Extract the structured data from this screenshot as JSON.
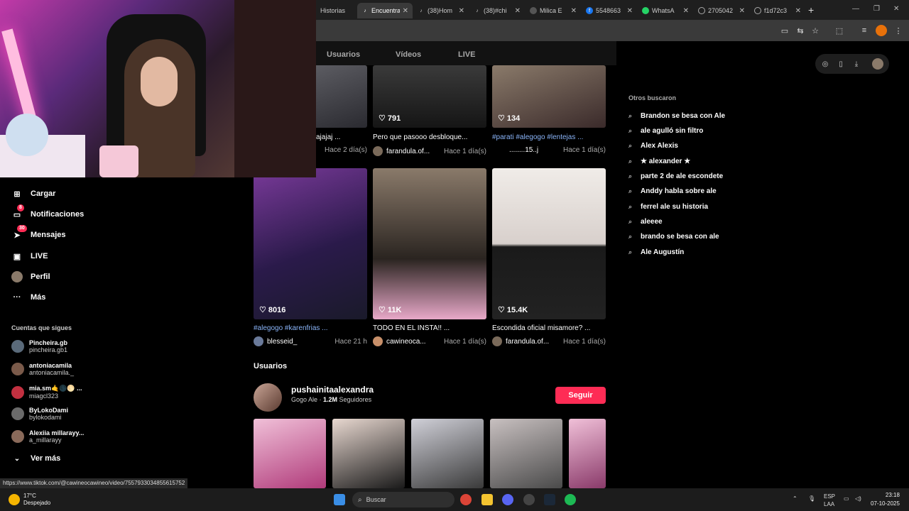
{
  "browser": {
    "tabs": [
      {
        "label": "Historias",
        "icon": "tiktok-icon",
        "active": false
      },
      {
        "label": "Encuentra",
        "icon": "tiktok-icon",
        "active": true
      },
      {
        "label": "(38)Hom",
        "icon": "tiktok-icon",
        "active": false
      },
      {
        "label": "(38)#chi",
        "icon": "tiktok-icon",
        "active": false
      },
      {
        "label": "Milica E",
        "icon": "site-icon",
        "active": false
      },
      {
        "label": "5548663",
        "icon": "facebook-icon",
        "active": false
      },
      {
        "label": "WhatsA",
        "icon": "whatsapp-icon",
        "active": false
      },
      {
        "label": "2705042",
        "icon": "globe-icon",
        "active": false
      },
      {
        "label": "f1d72c3",
        "icon": "globe-icon",
        "active": false
      }
    ],
    "status_url": "https://www.tiktok.com/@cawineocawineo/video/7557933034855615752"
  },
  "topnav": {
    "usuarios": "Usuarios",
    "videos": "Vídeos",
    "live": "LIVE"
  },
  "sidebar": {
    "items": [
      {
        "label": "Cargar",
        "icon": "upload-icon",
        "badge": ""
      },
      {
        "label": "Notificaciones",
        "icon": "inbox-icon",
        "badge": "8"
      },
      {
        "label": "Mensajes",
        "icon": "send-icon",
        "badge": "30"
      },
      {
        "label": "LIVE",
        "icon": "live-icon",
        "badge": ""
      },
      {
        "label": "Perfil",
        "icon": "avatar",
        "badge": ""
      },
      {
        "label": "Más",
        "icon": "more-icon",
        "badge": ""
      }
    ],
    "following_title": "Cuentas que sigues",
    "following": [
      {
        "name": "Pincheira.gb",
        "handle": "pincheira.gb1",
        "color": "#5a6a7a"
      },
      {
        "name": "antoniacamila",
        "handle": "antoniacamila._",
        "color": "#7a5a4a"
      },
      {
        "name": "mia.sm🤙🌑🌕 ...",
        "handle": "miagcl323",
        "color": "#c23040"
      },
      {
        "name": "ByLokoDami",
        "handle": "bylokodami",
        "color": "#6a6a6a"
      },
      {
        "name": "Alexiia millarayy...",
        "handle": "a_millarayy",
        "color": "#8a6a5a"
      }
    ],
    "ver_mas": "Ver más"
  },
  "videos_row1": [
    {
      "likes": "",
      "title": "ajajaj ...",
      "is_tag": false,
      "author": "",
      "time": "Hace 2 día(s)"
    },
    {
      "likes": "791",
      "title": "Pero que pasooo desbloque...",
      "is_tag": false,
      "author": "farandula.of...",
      "time": "Hace 1 día(s)"
    },
    {
      "likes": "134",
      "title": "#parati #alegogo #lentejas ...",
      "is_tag": true,
      "author": "........15..j",
      "time": "Hace 1 día(s)"
    }
  ],
  "videos_row2": [
    {
      "likes": "8016",
      "title": "#alegogo #karenfrias ...",
      "is_tag": true,
      "author": "blesseid_",
      "time": "Hace 21 h"
    },
    {
      "likes": "11K",
      "title": "TODO EN EL INSTA!! ...",
      "is_tag": false,
      "author": "cawineoca...",
      "time": "Hace 1 día(s)"
    },
    {
      "likes": "15.4K",
      "title": "Escondida oficial misamore? ...",
      "is_tag": false,
      "author": "farandula.of...",
      "time": "Hace 1 día(s)"
    }
  ],
  "users_section": {
    "heading": "Usuarios",
    "name": "pushainitaalexandra",
    "sub_prefix": "Gogo Ale · ",
    "followers": "1.2M",
    "followers_label": " Seguidores",
    "follow_button": "Seguir"
  },
  "other_searches": {
    "title": "Otros buscaron",
    "items": [
      "Brandon se besa con Ale",
      "ale agulló sin filtro",
      "Alex Alexis",
      "★ alexander ★",
      "parte 2 de ale escondete",
      "Anddy habla sobre ale",
      "ferrel ale su historia",
      "aleeee",
      "brando se besa con ale",
      "Ale Augustín"
    ]
  },
  "taskbar": {
    "temp": "17°C",
    "weather": "Despejado",
    "search_placeholder": "Buscar",
    "lang": "ESP",
    "region": "LAA",
    "time": "23:18",
    "date": "07-10-2025"
  },
  "colors": {
    "accent": "#fe2c55",
    "tag": "#8ab4f8"
  }
}
